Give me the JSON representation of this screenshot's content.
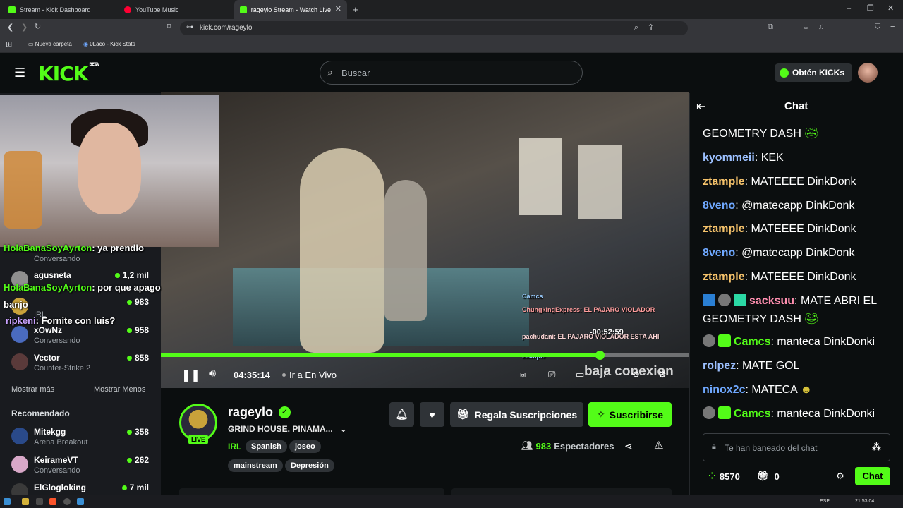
{
  "browser": {
    "tabs": [
      {
        "label": "Stream - Kick Dashboard",
        "color": "#53fc18"
      },
      {
        "label": "YouTube Music",
        "color": "#ff0033"
      },
      {
        "label": "rageylo Stream - Watch Live",
        "color": "#53fc18"
      }
    ],
    "url": "kick.com/rageylo",
    "bookmarks": [
      "Nueva carpeta",
      "0Laco - Kick Stats"
    ]
  },
  "header": {
    "logo": "KICK",
    "logo_badge": "BETA",
    "search_placeholder": "Buscar",
    "kicks_label": "Obtén KICKs"
  },
  "sidebar": {
    "channels": [
      {
        "name": "HolaBanaSoyAyrton",
        "category": "Conversando",
        "viewers": "",
        "color": "#7a5cff"
      },
      {
        "name": "agusneta",
        "category": "Conversando",
        "viewers": "1,2 mil",
        "color": "#8f8f8f"
      },
      {
        "name": "apagobanjo",
        "category": "IRL",
        "viewers": "983",
        "color": "#c9a23a"
      },
      {
        "name": "xOwNz",
        "category": "Conversando",
        "viewers": "958",
        "color": "#4a6bbf"
      },
      {
        "name": "Vector",
        "category": "Counter-Strike 2",
        "viewers": "858",
        "color": "#5a3a3a"
      }
    ],
    "show_more": "Mostrar más",
    "show_less": "Mostrar Menos",
    "recommended_title": "Recomendado",
    "recommended": [
      {
        "name": "Mitekgg",
        "category": "Arena Breakout",
        "viewers": "358",
        "color": "#2a4a8a"
      },
      {
        "name": "KeirameVT",
        "category": "Conversando",
        "viewers": "262",
        "color": "#d8a8c8"
      },
      {
        "name": "ElGlogloking",
        "category": "",
        "viewers": "7 mil",
        "color": "#3a3a3a"
      }
    ]
  },
  "overlay_chat": [
    {
      "user": "HolaBanaSoyAyrton",
      "text": ": ya prendio"
    },
    {
      "user": "HolaBanaSoyAyrton",
      "text": ": por que apago banjo"
    },
    {
      "user": "ripkeni",
      "text": ": Fornite con luis?"
    }
  ],
  "video": {
    "time": "04:35:14",
    "live_label": "Ir a En Vivo",
    "progress": 0.83,
    "countdown": "-00:52:59",
    "caption": "baja conexion",
    "onscreen_chat": [
      "Camcs",
      "ChungkingExpress: EL PAJARO VIOLADOR",
      "pachudani: EL PAJARO VIOLADOR ESTA AHI",
      "ztample"
    ]
  },
  "stream": {
    "name": "rageylo",
    "live": "LIVE",
    "title": "GRIND HOUSE. PINAMA...",
    "category": "IRL",
    "tags": [
      "Spanish",
      "joseo",
      "mainstream",
      "Depresión"
    ],
    "gift_label": "Regala Suscripciones",
    "subscribe_label": "Suscribirse",
    "viewers": "983",
    "viewers_label": "Espectadores"
  },
  "chat": {
    "title": "Chat",
    "messages": [
      {
        "user": "",
        "user_color": "#ffffff",
        "text": "GEOMETRY DASH"
      },
      {
        "user": "kyommeii",
        "user_color": "#9cc0ff",
        "text": ": KEK"
      },
      {
        "user": "ztample",
        "user_color": "#f5c26b",
        "text": ": MATEEEE DinkDonk"
      },
      {
        "user": "8veno",
        "user_color": "#6fa8ff",
        "text": ": @matecapp DinkDonk"
      },
      {
        "user": "ztample",
        "user_color": "#f5c26b",
        "text": ": MATEEEE DinkDonk"
      },
      {
        "user": "8veno",
        "user_color": "#6fa8ff",
        "text": ": @matecapp DinkDonk"
      },
      {
        "user": "ztample",
        "user_color": "#f5c26b",
        "text": ": MATEEEE DinkDonk"
      },
      {
        "user": "sacksuu",
        "user_color": "#ff8fb0",
        "text": ": MATE ABRI EL GEOMETRY DASH"
      },
      {
        "user": "Camcs",
        "user_color": "#53fc18",
        "text": ": manteca DinkDonki"
      },
      {
        "user": "rolpez",
        "user_color": "#9cc0ff",
        "text": ": MATE GOL"
      },
      {
        "user": "ninox2c",
        "user_color": "#6fa8ff",
        "text": ": MATECA"
      },
      {
        "user": "Camcs",
        "user_color": "#53fc18",
        "text": ": manteca DinkDonki"
      }
    ],
    "input_placeholder": "Te han baneado del chat",
    "points": "8570",
    "gifts": "0",
    "send_label": "Chat"
  },
  "taskbar": {
    "lang": "ESP",
    "time": "21:53:04"
  },
  "colors": {
    "brand": "#53fc18",
    "bg": "#0b0e0f"
  }
}
